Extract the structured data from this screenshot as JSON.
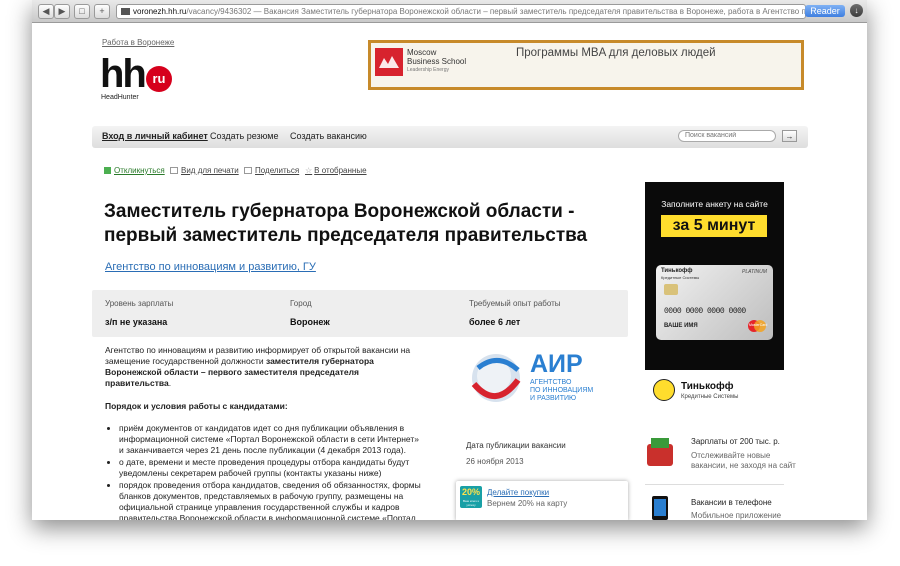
{
  "browser": {
    "nav_back": "◀",
    "nav_forward": "▶",
    "tab_icon": "□",
    "add_tab": "+",
    "url_host": "voronezh.hh.ru",
    "url_rest": "/vacancy/9436302 — Вакансия Заместитель губернатора Воронежской области – первый заместитель председателя правительства в Воронеже, работа в Агентство по инновациям и разв...",
    "reader_label": "Reader",
    "download_glyph": "↓"
  },
  "header": {
    "region_link": "Работа в Воронеже",
    "logo_main": "hh",
    "logo_badge": "ru",
    "logo_caption": "HeadHunter",
    "banner": {
      "brand_line1": "Moscow",
      "brand_line2": "Business School",
      "brand_line3": "Leadership Energy",
      "text": "Программы MBA для деловых людей"
    }
  },
  "navbar": {
    "login": "Вход в личный кабинет",
    "create_resume": "Создать резюме",
    "create_vacancy": "Создать вакансию",
    "search_placeholder": "Поиск вакансий",
    "search_go": "→"
  },
  "actions": {
    "respond": "Откликнуться",
    "print": "Вид для печати",
    "share": "Поделиться",
    "favorite": "В отобранные"
  },
  "vacancy": {
    "title": "Заместитель губернатора Воронежской области - первый заместитель председателя правительства",
    "company": "Агентство по инновациям и развитию, ГУ",
    "salary_label": "Уровень зарплаты",
    "salary_value": "з/п не указана",
    "city_label": "Город",
    "city_value": "Воронеж",
    "exp_label": "Требуемый опыт работы",
    "exp_value": "более 6 лет",
    "intro_plain": "Агентство по инновациям и развитию информирует об открытой вакансии на замещение государственной должности ",
    "intro_bold": "заместителя губернатора Воронежской области – первого заместителя председателя правительства",
    "intro_end": ".",
    "section_title": "Порядок и условия работы с кандидатами:",
    "bullets": [
      "приём документов от кандидатов идет со дня публикации объявления в информационной системе «Портал Воронежской области в сети Интернет» и заканчивается через 21 день после публикации (4 декабря 2013 года).",
      "о дате, времени и месте проведения процедуры отбора кандидаты будут уведомлены секретарем рабочей группы (контакты указаны ниже)",
      "порядок проведения отбора кандидатов, сведения об обязанностях, формы бланков документов, представляемых в рабочую группу, размещены на официальной странице управления государственной службы и кадров правительства Воронежской области в информационной системе «Портал Воронежской области в сети Интернет» по адресу: www.govvrn.ru"
    ],
    "air_logo_text": "АИР",
    "air_sub1": "АГЕНТСТВО",
    "air_sub2": "ПО ИННОВАЦИЯМ",
    "air_sub3": "И РАЗВИТИЮ",
    "pubdate_label": "Дата публикации вакансии",
    "pubdate_value": "26 ноября 2013",
    "promo_badge": "20%",
    "promo_badge_sub": "Ваш ключ к успеху",
    "promo_link": "Делайте покупки",
    "promo_sub": "Вернем 20% на карту"
  },
  "sidebar": {
    "ad_line1": "Заполните анкету на сайте",
    "ad_highlight": "за 5 минут",
    "card_brand": "Тинькофф",
    "card_brand_sub": "Кредитные Системы",
    "card_platinum": "PLATINUM",
    "card_number": "0000 0000 0000 0000",
    "card_name": "ВАШЕ ИМЯ",
    "card_mastercard": "MasterCard",
    "ad_brand": "Тинькофф",
    "ad_brand_sub": "Кредитные Системы",
    "row1_title": "Зарплаты от 200 тыс. р.",
    "row1_sub1": "Отслеживайте новые",
    "row1_sub2": "вакансии, не заходя на сайт",
    "row2_title": "Вакансии в телефоне",
    "row2_sub": "Мобильное приложение"
  }
}
